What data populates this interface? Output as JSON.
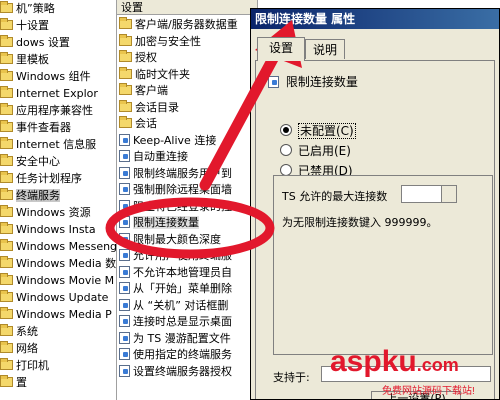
{
  "left_tree": {
    "items": [
      {
        "label": "机”策略",
        "selected": false
      },
      {
        "label": "十设置",
        "selected": false
      },
      {
        "label": "dows 设置",
        "selected": false
      },
      {
        "label": "里模板",
        "selected": false
      },
      {
        "label": "Windows 组件",
        "selected": false
      },
      {
        "label": "Internet Explor",
        "selected": false
      },
      {
        "label": "应用程序兼容性",
        "selected": false
      },
      {
        "label": "事件查看器",
        "selected": false
      },
      {
        "label": "Internet 信息服",
        "selected": false
      },
      {
        "label": "安全中心",
        "selected": false
      },
      {
        "label": "任务计划程序",
        "selected": false
      },
      {
        "label": "终端服务",
        "selected": true
      },
      {
        "label": "Windows 资源",
        "selected": false
      },
      {
        "label": "Windows Insta",
        "selected": false
      },
      {
        "label": "Windows Messeng",
        "selected": false
      },
      {
        "label": "Windows Media 数",
        "selected": false
      },
      {
        "label": "Windows Movie M",
        "selected": false
      },
      {
        "label": "Windows Update",
        "selected": false
      },
      {
        "label": "Windows Media P",
        "selected": false
      },
      {
        "label": "系统",
        "selected": false
      },
      {
        "label": "网络",
        "selected": false
      },
      {
        "label": "打印机",
        "selected": false
      },
      {
        "label": "置",
        "selected": false
      }
    ]
  },
  "middle_list": {
    "header": "设置",
    "items": [
      {
        "label": "客户端/服务器数据重",
        "type": "folder",
        "selected": false
      },
      {
        "label": "加密与安全性",
        "type": "folder",
        "selected": false
      },
      {
        "label": "授权",
        "type": "folder",
        "selected": false
      },
      {
        "label": "临时文件夹",
        "type": "folder",
        "selected": false
      },
      {
        "label": "客户端",
        "type": "folder",
        "selected": false
      },
      {
        "label": "会话目录",
        "type": "folder",
        "selected": false
      },
      {
        "label": "会话",
        "type": "folder",
        "selected": false
      },
      {
        "label": "Keep-Alive 连接",
        "type": "policy",
        "selected": false
      },
      {
        "label": "自动重连接",
        "type": "policy",
        "selected": false
      },
      {
        "label": "限制终端服务用户到",
        "type": "policy",
        "selected": false
      },
      {
        "label": "强制删除远程桌面墙",
        "type": "policy",
        "selected": false
      },
      {
        "label": "阻止将已经登录的控",
        "type": "policy",
        "selected": false
      },
      {
        "label": "限制连接数量",
        "type": "policy",
        "selected": true
      },
      {
        "label": "限制最大颜色深度",
        "type": "policy",
        "selected": false
      },
      {
        "label": "允许用户使用终端服",
        "type": "policy",
        "selected": false
      },
      {
        "label": "不允许本地管理员自",
        "type": "policy",
        "selected": false
      },
      {
        "label": "从「开始」菜单删除",
        "type": "policy",
        "selected": false
      },
      {
        "label": "从 “关机” 对话框删",
        "type": "policy",
        "selected": false
      },
      {
        "label": "连接时总是显示桌面",
        "type": "policy",
        "selected": false
      },
      {
        "label": "为 TS 漫游配置文件",
        "type": "policy",
        "selected": false
      },
      {
        "label": "使用指定的终端服务",
        "type": "policy",
        "selected": false
      },
      {
        "label": "设置终端服务器授权",
        "type": "policy",
        "selected": false
      }
    ]
  },
  "dialog": {
    "title": "限制连接数量 属性",
    "tabs": [
      "设置",
      "说明"
    ],
    "policy_name": "限制连接数量",
    "radios": [
      {
        "label": "未配置(C)",
        "checked": true
      },
      {
        "label": "已启用(E)",
        "checked": false
      },
      {
        "label": "已禁用(D)",
        "checked": false
      }
    ],
    "max_label": "TS 允许的最大连接数",
    "hint": "为无限制连接数键入 999999。",
    "supported_label": "支持于:",
    "prev_button": "上一设置(P)"
  },
  "watermark": {
    "brand": "aspku",
    "domain": ".com",
    "sub": "免费网站源码下载站!"
  },
  "colors": {
    "titlebar": "#0a246a",
    "annotation": "#e2182c"
  }
}
